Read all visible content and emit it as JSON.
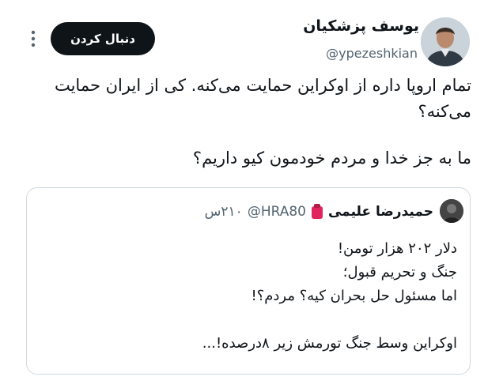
{
  "author": {
    "name": "یوسف پزشکیان",
    "handle": "@ypezeshkian"
  },
  "follow_button": {
    "label": "دنبال کردن"
  },
  "tweet": {
    "lines": [
      "تمام اروپا داره از اوکراین حمایت می‌کنه. کی از ایران حمایت می‌کنه؟",
      "ما به جز خدا و مردم خودمون کیو داریم؟"
    ]
  },
  "quoted": {
    "name": "حمیدرضا علیمی",
    "handle": "@HRA80",
    "time": "۲۱۰س",
    "lines": [
      "دلار ۲۰۲ هزار تومن!",
      "جنگ و تحریم قبول؛",
      "اما مسئول حل بحران کیه؟ مردم؟!",
      "",
      "اوکراین وسط جنگ تورمش زیر ۸درصده!..."
    ]
  },
  "colors": {
    "follow_bg": "#0f1419",
    "secondary_text": "#536471",
    "border": "#cfd9de",
    "badge": "#e0245e"
  }
}
